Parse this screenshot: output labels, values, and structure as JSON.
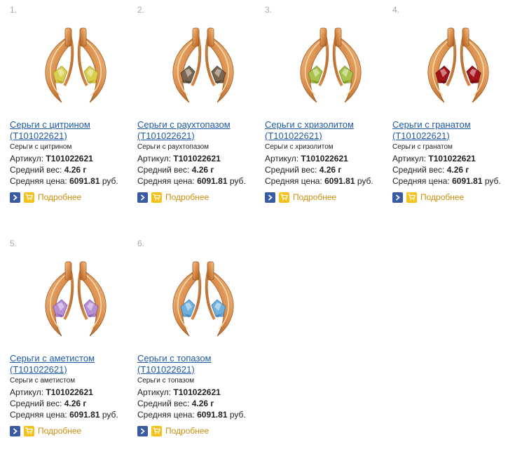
{
  "products": [
    {
      "num": "1.",
      "title": "Серьги с цитрином (Т101022621)",
      "subtitle": "Серьги с цитрином",
      "sku_label": "Артикул:",
      "sku": "Т101022621",
      "weight_label": "Средний вес:",
      "weight": "4.26 г",
      "price_label": "Средняя цена:",
      "price": "6091.81",
      "currency": "руб.",
      "more": "Подробнее",
      "stone_color": "#d9cf4e",
      "stone_dark": "#a89a1f"
    },
    {
      "num": "2.",
      "title": "Серьги с раухтопазом (Т101022621)",
      "subtitle": "Серьги с раухтопазом",
      "sku_label": "Артикул:",
      "sku": "Т101022621",
      "weight_label": "Средний вес:",
      "weight": "4.26 г",
      "price_label": "Средняя цена:",
      "price": "6091.81",
      "currency": "руб.",
      "more": "Подробнее",
      "stone_color": "#7a6650",
      "stone_dark": "#3f3226"
    },
    {
      "num": "3.",
      "title": "Серьги с хризолитом (Т101022621)",
      "subtitle": "Серьги с хризолитом",
      "sku_label": "Артикул:",
      "sku": "Т101022621",
      "weight_label": "Средний вес:",
      "weight": "4.26 г",
      "price_label": "Средняя цена:",
      "price": "6091.81",
      "currency": "руб.",
      "more": "Подробнее",
      "stone_color": "#a9c24a",
      "stone_dark": "#6c8a1e"
    },
    {
      "num": "4.",
      "title": "Серьги с гранатом (Т101022621)",
      "subtitle": "Серьги с гранатом",
      "sku_label": "Артикул:",
      "sku": "Т101022621",
      "weight_label": "Средний вес:",
      "weight": "4.26 г",
      "price_label": "Средняя цена:",
      "price": "6091.81",
      "currency": "руб.",
      "more": "Подробнее",
      "stone_color": "#a3141a",
      "stone_dark": "#5e0408"
    },
    {
      "num": "5.",
      "title": "Серьги с аметистом (Т101022621)",
      "subtitle": "Серьги с аметистом",
      "sku_label": "Артикул:",
      "sku": "Т101022621",
      "weight_label": "Средний вес:",
      "weight": "4.26 г",
      "price_label": "Средняя цена:",
      "price": "6091.81",
      "currency": "руб.",
      "more": "Подробнее",
      "stone_color": "#b891d4",
      "stone_dark": "#7a4ea1"
    },
    {
      "num": "6.",
      "title": "Серьги с топазом (Т101022621)",
      "subtitle": "Серьги с топазом",
      "sku_label": "Артикул:",
      "sku": "Т101022621",
      "weight_label": "Средний вес:",
      "weight": "4.26 г",
      "price_label": "Средняя цена:",
      "price": "6091.81",
      "currency": "руб.",
      "more": "Подробнее",
      "stone_color": "#6fb1dc",
      "stone_dark": "#2f78ad"
    }
  ]
}
